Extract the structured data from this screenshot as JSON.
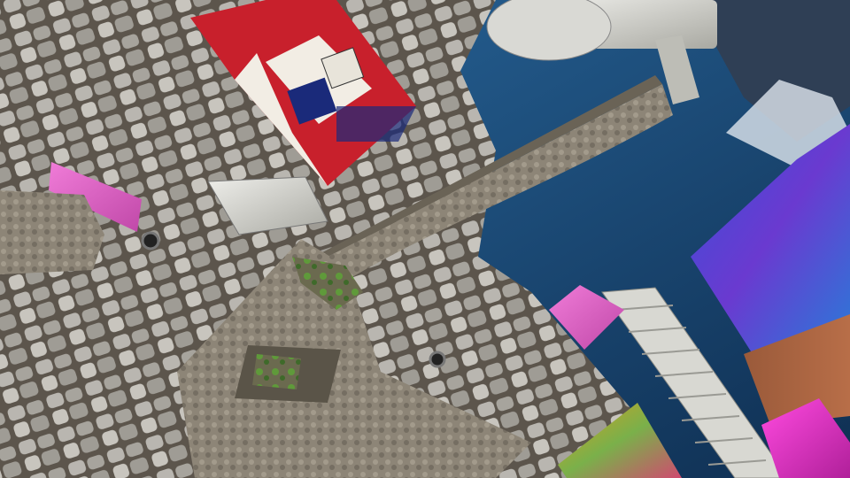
{
  "scene": {
    "kind": "3d-game-viewport",
    "hud_text": [],
    "colors": {
      "sky_blue": "#1f5a8a",
      "sky_dark": "#0f2f52",
      "cobblestone_base": "#8c8a86",
      "cobblestone_stone": "#b9b6b0",
      "cobblestone_mortar": "#5c554c",
      "magenta_cube": "#e83bd8",
      "pink_cube": "#f07cd8",
      "iridescent_blue": "#3a4fd8",
      "wooden_deck": "#9a5a3a",
      "union_jack_red": "#c8202c",
      "union_jack_blue": "#1a2a7a",
      "concrete": "#8d8577",
      "rusted_silver": "#cfcfca",
      "moss_green": "#5f9a3a"
    },
    "objects": [
      {
        "id": "cobblestone-floor",
        "icon": "cobblestone-texture"
      },
      {
        "id": "sky-mountains",
        "icon": "sky-texture"
      },
      {
        "id": "union-jack-cabinet",
        "icon": "union-jack-texture"
      },
      {
        "id": "curved-stone-ramp",
        "icon": "concrete-texture"
      },
      {
        "id": "mossy-stone-block",
        "icon": "moss-texture"
      },
      {
        "id": "metal-rack",
        "icon": "rack-shape"
      },
      {
        "id": "telescope-pipe",
        "icon": "pipe-shape"
      },
      {
        "id": "iridescent-wall",
        "icon": "gradient-texture"
      },
      {
        "id": "magenta-cube",
        "icon": "cube-shape"
      },
      {
        "id": "pink-cube-left",
        "icon": "cube-shape"
      },
      {
        "id": "stone-block-left",
        "icon": "cube-shape"
      },
      {
        "id": "cracked-metal-slab",
        "icon": "slab-shape"
      },
      {
        "id": "gradient-cone",
        "icon": "cone-shape"
      },
      {
        "id": "wooden-deck",
        "icon": "wood-texture"
      },
      {
        "id": "drain-grates",
        "icon": "grate-icon"
      }
    ]
  }
}
